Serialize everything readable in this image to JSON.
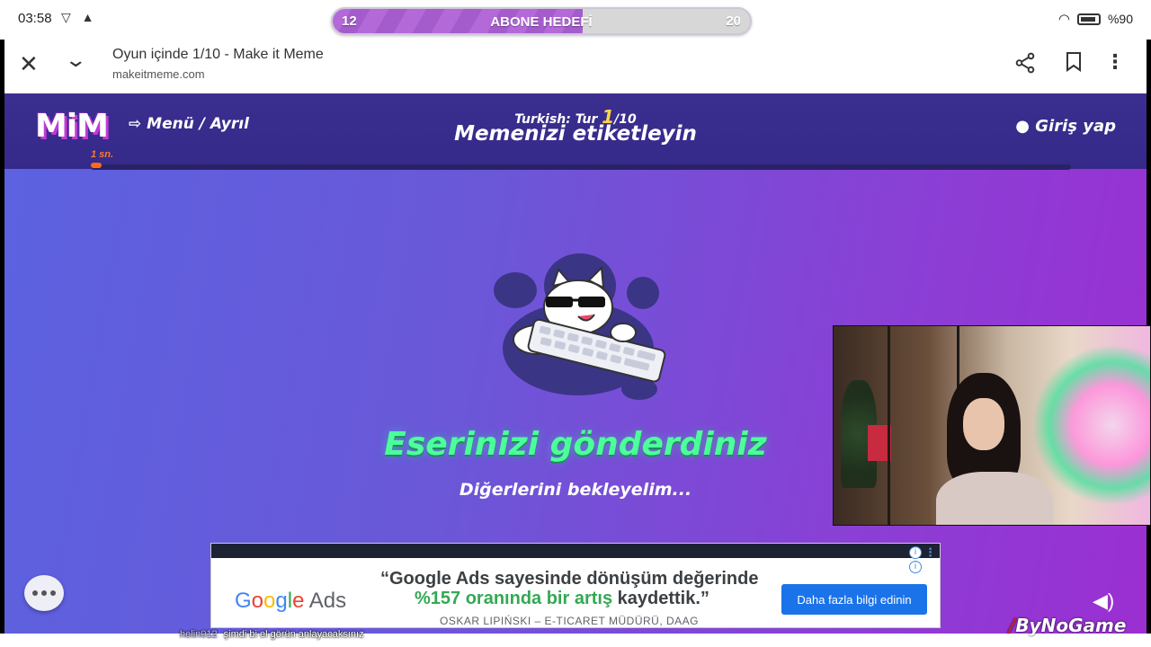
{
  "status_bar": {
    "time": "03:58",
    "battery": "%90"
  },
  "sub_goal": {
    "current": "12",
    "title": "ABONE HEDEFİ",
    "target": "20",
    "progress_fraction": 0.6
  },
  "browser": {
    "page_title": "Oyun içinde 1/10 - Make it Meme",
    "url": "makeitmeme.com"
  },
  "game": {
    "logo": "MiM",
    "timer": "1 sn.",
    "menu_label": "Menü / Ayrıl",
    "round_prefix": "Turkish: Tur",
    "round_current": "1",
    "round_total": "/10",
    "title": "Memenizi etiketleyin",
    "login_label": "Giriş yap",
    "submitted_message": "Eserinizi gönderdiniz",
    "wait_message": "Diğerlerini bekleyelim..."
  },
  "ad": {
    "logo_google": "Google",
    "logo_ads": "Ads",
    "quote_line1": "“Google Ads sayesinde dönüşüm değerinde",
    "quote_line2_highlight": "%157 oranında bir artış",
    "quote_line2_rest": "kaydettik.”",
    "author": "OSKAR LIPIŃSKI – E-TICARET MÜDÜRÜ, DAAG",
    "cta": "Daha fazla bilgi edinin"
  },
  "overlay": {
    "watermark": "ByNoGame",
    "chat_user": "helin012",
    "chat_message": "şimdi bi el görün anlayacaksınız"
  },
  "colors": {
    "game_bg_start": "#5b62e0",
    "game_bg_end": "#9b2fd2",
    "header_bg": "#3a2f8e",
    "accent_green": "#4dff9a",
    "goal_fill": "#b36ad8",
    "ad_button": "#1a73e8"
  }
}
